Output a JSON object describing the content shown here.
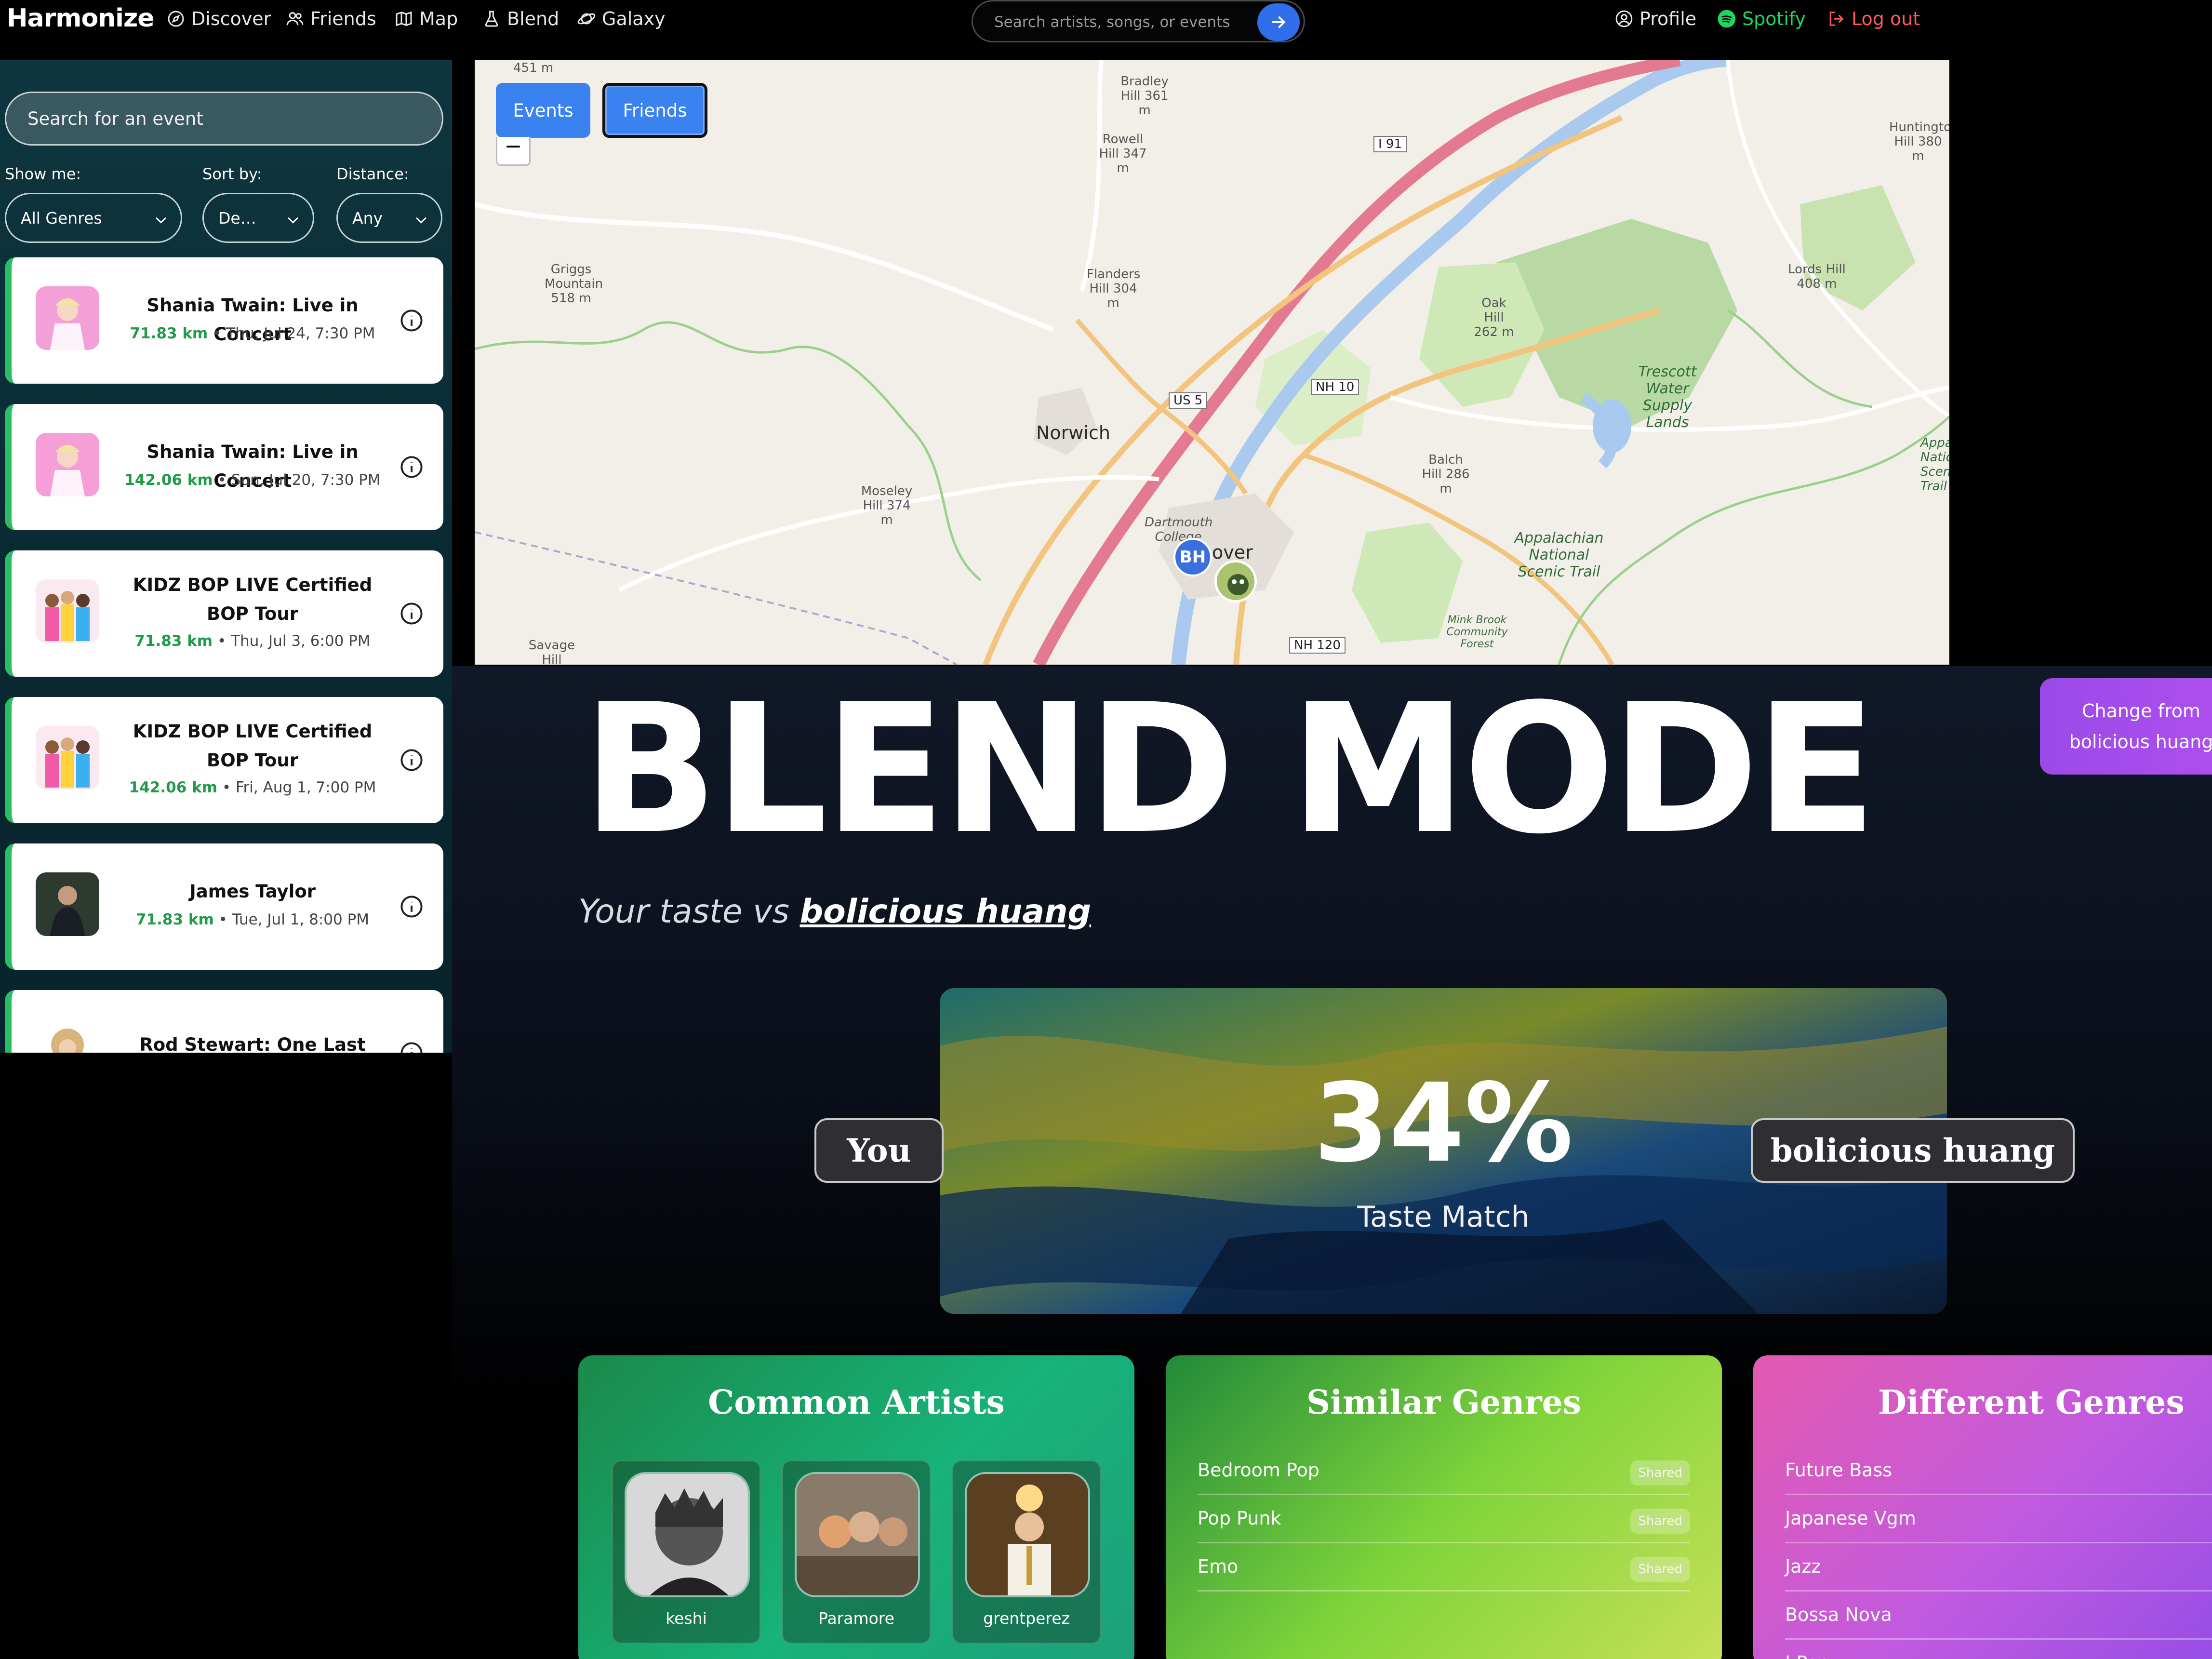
{
  "nav": {
    "brand": "Harmonize",
    "items": [
      {
        "label": "Discover",
        "icon": "compass-icon"
      },
      {
        "label": "Friends",
        "icon": "users-icon"
      },
      {
        "label": "Map",
        "icon": "map-icon"
      },
      {
        "label": "Blend",
        "icon": "flask-icon"
      },
      {
        "label": "Galaxy",
        "icon": "planet-icon"
      }
    ],
    "search_placeholder": "Search artists, songs, or events",
    "profile": "Profile",
    "spotify": "Spotify",
    "logout": "Log out",
    "colors": {
      "spotify": "#1ed760",
      "logout": "#ff5b5b",
      "accent": "#2f6ee8"
    }
  },
  "sidebar": {
    "search_placeholder": "Search for an event",
    "filters": {
      "show_label": "Show me:",
      "show_value": "All Genres",
      "sort_label": "Sort by:",
      "sort_value": "De…",
      "distance_label": "Distance:",
      "distance_value": "Any"
    },
    "events": [
      {
        "title": "Shania Twain: Live in Concert",
        "distance": "71.83 km",
        "date": " • Thu, Jul 24, 7:30 PM"
      },
      {
        "title": "Shania Twain: Live in Concert",
        "distance": "142.06 km",
        "date": " • Sun, Jul 20, 7:30 PM"
      },
      {
        "title": "KIDZ BOP LIVE Certified BOP Tour",
        "distance": "71.83 km",
        "date": " • Thu, Jul 3, 6:00 PM"
      },
      {
        "title": "KIDZ BOP LIVE Certified BOP Tour",
        "distance": "142.06 km",
        "date": " • Fri, Aug 1, 7:00 PM"
      },
      {
        "title": "James Taylor",
        "distance": "71.83 km",
        "date": " • Tue, Jul 1, 8:00 PM"
      },
      {
        "title": "Rod Stewart: One Last Time",
        "distance": "",
        "date": ""
      }
    ]
  },
  "map": {
    "tabs": {
      "events": "Events",
      "friends": "Friends"
    },
    "zoom_out": "−",
    "labels": {
      "norwich": "Norwich",
      "hanover": "over",
      "bradley": "Bradley Hill 361 m",
      "rowell": "Rowell Hill 347 m",
      "griggs": "Griggs Mountain 518 m",
      "flanders": "Flanders Hill 304 m",
      "oak": "Oak Hill 262 m",
      "lords": "Lords Hill 408 m",
      "huntington": "Huntington Hill 380 m",
      "moseley": "Moseley Hill 374 m",
      "balch": "Balch Hill 286 m",
      "savage": "Savage Hill",
      "trescott": "Trescott Water Supply Lands",
      "appalachian": "Appalachian National Scenic Trail",
      "minkbrook": "Mink Brook Community Forest",
      "dartmouth": "Dartmouth College",
      "top451": "451 m",
      "i91": "I 91",
      "us5": "US 5",
      "nh10": "NH 10",
      "nh120": "NH 120",
      "scenic": "Appalac Nation Scen Trail"
    },
    "friend_initials": "BH"
  },
  "blend": {
    "title": "BLEND MODE",
    "subtitle_prefix": "Your taste vs ",
    "partner": "bolicious huang",
    "change_button": "Change from bolicious huang",
    "match_percent": "34%",
    "match_label": "Taste Match",
    "you_label": "You",
    "partner_label": "bolicious huang"
  },
  "common_artists": {
    "title": "Common Artists",
    "artists": [
      "keshi",
      "Paramore",
      "grentperez"
    ]
  },
  "similar_genres": {
    "title": "Similar Genres",
    "badge": "Shared",
    "genres": [
      "Bedroom Pop",
      "Pop Punk",
      "Emo"
    ]
  },
  "different_genres": {
    "title": "Different Genres",
    "genres": [
      "Future Bass",
      "Japanese Vgm",
      "Jazz",
      "Bossa Nova",
      "J-Pop"
    ]
  }
}
